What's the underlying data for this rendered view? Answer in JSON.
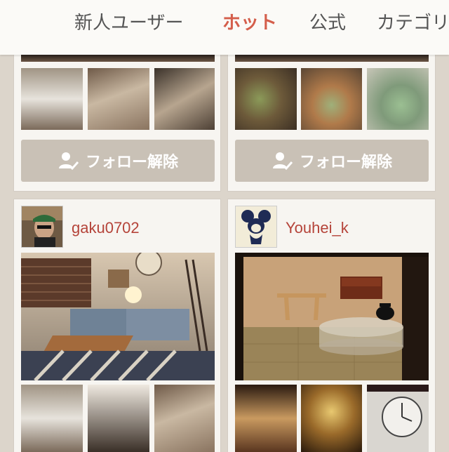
{
  "tabs": [
    {
      "label": "新人ユーザー",
      "active": false
    },
    {
      "label": "ホット",
      "active": true
    },
    {
      "label": "公式",
      "active": false
    },
    {
      "label": "カテゴリ",
      "active": false
    }
  ],
  "cards_top": {
    "left": {
      "follow_label": "フォロー解除"
    },
    "right": {
      "follow_label": "フォロー解除"
    }
  },
  "cards_bottom": {
    "left": {
      "username": "gaku0702"
    },
    "right": {
      "username": "Youhei_k"
    }
  },
  "colors": {
    "accent": "#d45e4b",
    "username": "#b5443a",
    "button": "#c9c1b6",
    "background": "#dcd5cb"
  },
  "icons": {
    "follow_icon": "user-check-icon"
  }
}
